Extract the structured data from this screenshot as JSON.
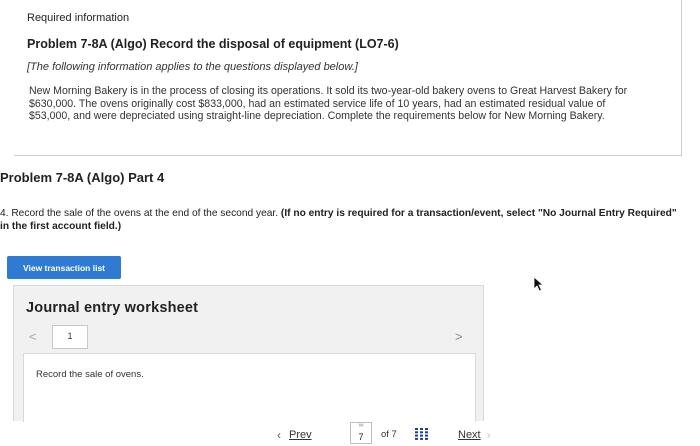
{
  "header": {
    "required_label": "Required information",
    "problem_title": "Problem 7-8A (Algo) Record the disposal of equipment (LO7-6)",
    "note": "[The following information applies to the questions displayed below.]",
    "description": "New Morning Bakery is in the process of closing its operations. It sold its two-year-old bakery ovens to Great Harvest Bakery for $630,000. The ovens originally cost $833,000, had an estimated service life of 10 years, had an estimated residual value of $53,000, and were depreciated using straight-line depreciation. Complete the requirements below for New Morning Bakery."
  },
  "part": {
    "title": "Problem 7-8A (Algo) Part 4",
    "instruction_text": "4. Record the sale of the ovens at the end of the second year. ",
    "instruction_bold": "(If no entry is required for a transaction/event, select \"No Journal Entry Required\" in the first account field.)"
  },
  "buttons": {
    "view_transaction_list": "View transaction list"
  },
  "worksheet": {
    "title": "Journal entry worksheet",
    "prev_glyph": "<",
    "next_glyph": ">",
    "current_tab": "1",
    "entry_text": "Record the sale of ovens."
  },
  "pager": {
    "prev_label": "Prev",
    "next_label": "Next",
    "current_page": "7",
    "of_text": "of 7"
  },
  "colors": {
    "button_blue": "#2f7bd3",
    "worksheet_bg": "#f1f1f1"
  },
  "icons": [
    "chevron-left-icon",
    "chevron-right-icon",
    "link-icon",
    "grid-icon",
    "mouse-cursor-icon"
  ]
}
